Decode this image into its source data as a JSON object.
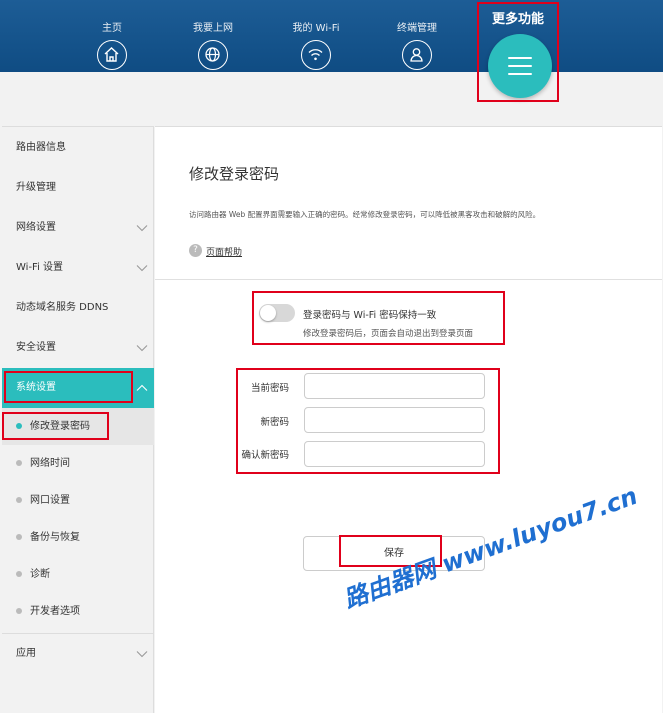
{
  "nav": {
    "items": [
      {
        "label": "主页",
        "icon": "home-icon"
      },
      {
        "label": "我要上网",
        "icon": "globe-icon"
      },
      {
        "label": "我的 Wi-Fi",
        "icon": "wifi-icon"
      },
      {
        "label": "终端管理",
        "icon": "user-icon"
      }
    ],
    "more": {
      "label": "更多功能",
      "icon": "menu-icon"
    }
  },
  "sidebar": {
    "items": [
      {
        "label": "路由器信息"
      },
      {
        "label": "升级管理"
      },
      {
        "label": "网络设置",
        "expandable": true
      },
      {
        "label": "Wi-Fi 设置",
        "expandable": true
      },
      {
        "label": "动态域名服务 DDNS"
      },
      {
        "label": "安全设置",
        "expandable": true
      },
      {
        "label": "系统设置",
        "expandable": true,
        "active": true
      },
      {
        "label": "应用",
        "expandable": true
      }
    ],
    "sub_items": [
      {
        "label": "修改登录密码",
        "active": true
      },
      {
        "label": "网络时间"
      },
      {
        "label": "网口设置"
      },
      {
        "label": "备份与恢复"
      },
      {
        "label": "诊断"
      },
      {
        "label": "开发者选项"
      }
    ]
  },
  "main": {
    "title": "修改登录密码",
    "description": "访问路由器 Web 配置界面需要输入正确的密码。经常修改登录密码，可以降低被黑客攻击和破解的风险。",
    "help_link": "页面帮助",
    "help_icon": "?",
    "sync_toggle": {
      "label": "登录密码与 Wi-Fi 密码保持一致",
      "hint": "修改登录密码后，页面会自动退出到登录页面",
      "on": false
    },
    "fields": {
      "current_password": {
        "label": "当前密码",
        "value": ""
      },
      "new_password": {
        "label": "新密码",
        "value": ""
      },
      "confirm_password": {
        "label": "确认新密码",
        "value": ""
      }
    },
    "save_label": "保存"
  },
  "watermark": "路由器网 www.luyou7.cn",
  "colors": {
    "topbar": "#0f4c83",
    "accent": "#2bbdbd",
    "highlight": "#e0001b"
  }
}
